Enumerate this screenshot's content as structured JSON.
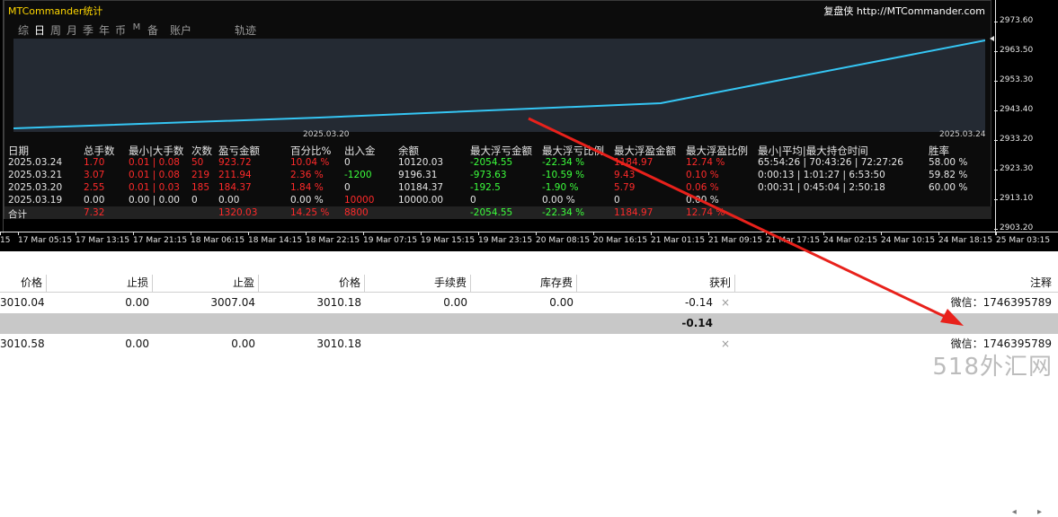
{
  "panel": {
    "title": "MTCommander统计",
    "site": "复盘侠 http://MTCommander.com",
    "tabs": [
      "综",
      "日",
      "周",
      "月",
      "季",
      "年",
      "币",
      "M",
      "备",
      "账户",
      "轨迹"
    ],
    "active_tab": "日",
    "mini_chart": {
      "start_label": "2025.03.20",
      "mid_label": "2025.03.20",
      "end_label": "2025.03.24",
      "line_color": "#35c6f4"
    }
  },
  "stats": {
    "headers": [
      "日期",
      "总手数",
      "最小|大手数",
      "次数",
      "盈亏金额",
      "百分比%",
      "出入金",
      "余额",
      "最大浮亏金额",
      "最大浮亏比例",
      "最大浮盈金额",
      "最大浮盈比例",
      "最小|平均|最大持仓时间",
      "胜率"
    ],
    "rows": [
      [
        "2025.03.24",
        "1.70",
        "0.01 | 0.08",
        "50",
        "923.72",
        "10.04 %",
        "0",
        "10120.03",
        "-2054.55",
        "-22.34 %",
        "1184.97",
        "12.74 %",
        "65:54:26 | 70:43:26 | 72:27:26",
        "58.00 %"
      ],
      [
        "2025.03.21",
        "3.07",
        "0.01 | 0.08",
        "219",
        "211.94",
        "2.36 %",
        "-1200",
        "9196.31",
        "-973.63",
        "-10.59 %",
        "9.43",
        "0.10 %",
        "0:00:13 | 1:01:27 | 6:53:50",
        "59.82 %"
      ],
      [
        "2025.03.20",
        "2.55",
        "0.01 | 0.03",
        "185",
        "184.37",
        "1.84 %",
        "0",
        "10184.37",
        "-192.5",
        "-1.90 %",
        "5.79",
        "0.06 %",
        "0:00:31 | 0:45:04 | 2:50:18",
        "60.00 %"
      ],
      [
        "2025.03.19",
        "0.00",
        "0.00 | 0.00",
        "0",
        "0.00",
        "0.00 %",
        "10000",
        "10000.00",
        "0",
        "0.00 %",
        "0",
        "0.00 %",
        "",
        ""
      ]
    ],
    "total": [
      "合计",
      "7.32",
      "",
      "",
      "1320.03",
      "14.25 %",
      "8800",
      "",
      "-2054.55",
      "-22.34 %",
      "1184.97",
      "12.74 %",
      "",
      ""
    ]
  },
  "yaxis": [
    "2973.60",
    "2963.50",
    "2953.30",
    "2943.40",
    "2933.20",
    "2923.30",
    "2913.10",
    "2903.20"
  ],
  "xaxis": [
    "15",
    "17 Mar 05:15",
    "17 Mar 13:15",
    "17 Mar 21:15",
    "18 Mar 06:15",
    "18 Mar 14:15",
    "18 Mar 22:15",
    "19 Mar 07:15",
    "19 Mar 15:15",
    "19 Mar 23:15",
    "20 Mar 08:15",
    "20 Mar 16:15",
    "21 Mar 01:15",
    "21 Mar 09:15",
    "21 Mar 17:15",
    "24 Mar 02:15",
    "24 Mar 10:15",
    "24 Mar 18:15",
    "25 Mar 03:15"
  ],
  "table": {
    "headers": [
      "价格",
      "止损",
      "止盈",
      "价格",
      "手续费",
      "库存费",
      "获利",
      "注释"
    ],
    "rows": [
      {
        "price": "3010.04",
        "sl": "0.00",
        "tp": "3007.04",
        "price2": "3010.18",
        "commission": "0.00",
        "swap": "0.00",
        "profit": "-0.14",
        "comment": "微信：1746395789"
      },
      {
        "price": "",
        "sl": "",
        "tp": "",
        "price2": "",
        "commission": "",
        "swap": "",
        "profit": "-0.14",
        "comment": ""
      },
      {
        "price": "3010.58",
        "sl": "0.00",
        "tp": "0.00",
        "price2": "3010.18",
        "commission": "",
        "swap": "",
        "profit": "",
        "comment": "微信：1746395789"
      }
    ],
    "close_glyph": "×",
    "scroll_glyphs": "◂ ▸"
  },
  "watermark": "518外汇网"
}
